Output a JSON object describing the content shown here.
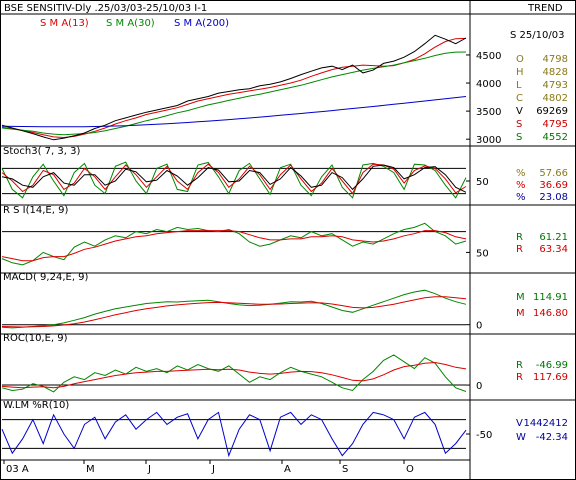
{
  "header": {
    "title": "BSE SENSITIV-Dly .25/03/03-25/10/03  I-1",
    "trend": "TREND"
  },
  "colors": {
    "black": "#000000",
    "red": "#dd0000",
    "green": "#008800",
    "blue": "#0000cc",
    "olive": "#8a7a1a",
    "darkred": "#cc0000",
    "darkgreen": "#007700",
    "navy": "#000099"
  },
  "chart_data": [
    {
      "type": "line",
      "panel": "price",
      "legend": [
        "S M A(13)",
        "S M A(30)",
        "S M A(200)"
      ],
      "date_label": "S 25/10/03",
      "yticks": [
        3000,
        3500,
        4000,
        4500
      ],
      "ylim": [
        2950,
        4980
      ],
      "readouts": [
        {
          "key": "O",
          "value": "4798",
          "color": "olive"
        },
        {
          "key": "H",
          "value": "4828",
          "color": "olive"
        },
        {
          "key": "L",
          "value": "4793",
          "color": "olive"
        },
        {
          "key": "C",
          "value": "4802",
          "color": "olive"
        },
        {
          "key": "V",
          "value": "69269",
          "color": "black"
        },
        {
          "key": "S",
          "value": "4795",
          "color": "darkred"
        },
        {
          "key": "S",
          "value": "4552",
          "color": "darkgreen"
        }
      ],
      "series": [
        {
          "name": "S M A(13)",
          "color": "red",
          "values": [
            3210,
            3190,
            3160,
            3120,
            3080,
            3040,
            3030,
            3050,
            3090,
            3140,
            3200,
            3270,
            3330,
            3380,
            3440,
            3480,
            3520,
            3560,
            3620,
            3680,
            3720,
            3760,
            3800,
            3830,
            3860,
            3890,
            3920,
            3960,
            4000,
            4050,
            4120,
            4180,
            4240,
            4280,
            4300,
            4320,
            4310,
            4300,
            4310,
            4360,
            4420,
            4520,
            4640,
            4740,
            4790,
            4795
          ]
        },
        {
          "name": "S M A(30)",
          "color": "green",
          "values": [
            3200,
            3180,
            3160,
            3140,
            3110,
            3090,
            3080,
            3090,
            3100,
            3120,
            3150,
            3190,
            3230,
            3280,
            3330,
            3370,
            3420,
            3470,
            3510,
            3560,
            3610,
            3650,
            3690,
            3730,
            3770,
            3800,
            3840,
            3880,
            3920,
            3960,
            4010,
            4060,
            4110,
            4150,
            4190,
            4230,
            4260,
            4290,
            4320,
            4360,
            4400,
            4440,
            4490,
            4530,
            4550,
            4552
          ]
        },
        {
          "name": "S M A(200)",
          "color": "blue",
          "values": [
            3230,
            3228,
            3226,
            3224,
            3222,
            3220,
            3220,
            3221,
            3223,
            3226,
            3230,
            3235,
            3241,
            3248,
            3256,
            3265,
            3275,
            3286,
            3297,
            3309,
            3322,
            3335,
            3349,
            3363,
            3378,
            3393,
            3409,
            3425,
            3441,
            3458,
            3475,
            3492,
            3510,
            3528,
            3546,
            3564,
            3583,
            3602,
            3621,
            3640,
            3660,
            3680,
            3700,
            3720,
            3740,
            3760
          ]
        },
        {
          "name": "price",
          "color": "black",
          "values": [
            3250,
            3200,
            3150,
            3100,
            3040,
            2990,
            3020,
            3060,
            3110,
            3190,
            3250,
            3330,
            3380,
            3430,
            3480,
            3520,
            3560,
            3600,
            3680,
            3720,
            3760,
            3820,
            3850,
            3880,
            3900,
            3950,
            3980,
            4020,
            4080,
            4150,
            4210,
            4270,
            4300,
            4240,
            4320,
            4180,
            4230,
            4350,
            4390,
            4460,
            4560,
            4700,
            4850,
            4780,
            4700,
            4802
          ]
        }
      ]
    },
    {
      "type": "line",
      "panel": "stoch",
      "title": "Stoch3( 7, 3, 3)",
      "ylim": [
        0,
        100
      ],
      "yticks": [
        50
      ],
      "hlines": [
        20,
        80
      ],
      "readouts": [
        {
          "key": "%",
          "value": "57.66",
          "color": "olive"
        },
        {
          "key": "%",
          "value": "36.69",
          "color": "darkred"
        },
        {
          "key": "%",
          "value": "23.08",
          "color": "navy"
        }
      ],
      "series": [
        {
          "name": "%",
          "color": "green",
          "values": [
            80,
            30,
            10,
            60,
            90,
            50,
            15,
            70,
            92,
            40,
            20,
            85,
            95,
            50,
            20,
            80,
            90,
            30,
            25,
            88,
            94,
            60,
            20,
            75,
            92,
            55,
            18,
            82,
            90,
            40,
            15,
            60,
            88,
            35,
            10,
            88,
            92,
            85,
            70,
            30,
            90,
            88,
            75,
            40,
            10,
            58
          ]
        },
        {
          "name": "%",
          "color": "red",
          "values": [
            70,
            50,
            25,
            40,
            75,
            65,
            30,
            45,
            80,
            60,
            30,
            60,
            88,
            65,
            35,
            60,
            85,
            50,
            30,
            70,
            90,
            70,
            35,
            55,
            85,
            65,
            30,
            65,
            88,
            55,
            25,
            45,
            80,
            50,
            20,
            70,
            90,
            88,
            78,
            45,
            75,
            86,
            80,
            55,
            22,
            37
          ]
        },
        {
          "name": "%",
          "color": "black",
          "values": [
            60,
            55,
            40,
            35,
            60,
            70,
            45,
            40,
            65,
            65,
            40,
            50,
            78,
            72,
            48,
            52,
            75,
            62,
            40,
            58,
            82,
            76,
            48,
            50,
            75,
            70,
            42,
            55,
            82,
            62,
            35,
            40,
            70,
            58,
            30,
            55,
            85,
            88,
            82,
            55,
            65,
            82,
            84,
            65,
            35,
            23
          ]
        }
      ]
    },
    {
      "type": "line",
      "panel": "rsi",
      "title": "R S I(14,E, 9)",
      "ylim": [
        35,
        85
      ],
      "yticks": [
        50
      ],
      "hlines": [
        70
      ],
      "readouts": [
        {
          "key": "R",
          "value": "61.21",
          "color": "darkgreen"
        },
        {
          "key": "R",
          "value": "63.34",
          "color": "darkred"
        }
      ],
      "series": [
        {
          "name": "R",
          "color": "green",
          "values": [
            44,
            40,
            38,
            42,
            50,
            46,
            43,
            55,
            60,
            56,
            62,
            66,
            64,
            70,
            68,
            72,
            70,
            74,
            72,
            73,
            71,
            70,
            72,
            68,
            60,
            56,
            58,
            62,
            66,
            64,
            70,
            66,
            68,
            62,
            56,
            60,
            58,
            63,
            68,
            72,
            74,
            78,
            70,
            66,
            58,
            61
          ]
        },
        {
          "name": "R",
          "color": "red",
          "values": [
            46,
            44,
            42,
            42,
            45,
            46,
            46,
            49,
            53,
            55,
            58,
            61,
            63,
            65,
            66,
            68,
            69,
            70,
            71,
            71,
            71,
            71,
            71,
            70,
            67,
            64,
            62,
            62,
            63,
            63,
            65,
            65,
            66,
            65,
            62,
            61,
            60,
            61,
            63,
            66,
            68,
            71,
            71,
            69,
            65,
            63
          ]
        }
      ]
    },
    {
      "type": "line",
      "panel": "macd",
      "title": "MACD( 9,24,E, 9)",
      "ylim": [
        -30,
        230
      ],
      "yticks": [
        0
      ],
      "hlines": [
        0
      ],
      "readouts": [
        {
          "key": "M",
          "value": "114.91",
          "color": "darkgreen"
        },
        {
          "key": "M",
          "value": "146.80",
          "color": "darkred"
        }
      ],
      "series": [
        {
          "name": "M",
          "color": "green",
          "values": [
            -15,
            -18,
            -15,
            -10,
            -5,
            0,
            10,
            25,
            40,
            60,
            75,
            90,
            100,
            110,
            120,
            125,
            130,
            128,
            132,
            135,
            138,
            130,
            120,
            112,
            108,
            110,
            115,
            122,
            130,
            128,
            132,
            120,
            100,
            80,
            70,
            90,
            110,
            130,
            150,
            170,
            185,
            195,
            175,
            150,
            130,
            115
          ]
        },
        {
          "name": "M",
          "color": "red",
          "values": [
            -10,
            -12,
            -13,
            -12,
            -10,
            -7,
            -2,
            5,
            15,
            28,
            42,
            56,
            68,
            80,
            90,
            98,
            106,
            112,
            117,
            121,
            125,
            126,
            124,
            121,
            118,
            116,
            116,
            117,
            120,
            122,
            124,
            123,
            117,
            108,
            98,
            95,
            98,
            106,
            116,
            128,
            140,
            152,
            158,
            158,
            152,
            147
          ]
        }
      ]
    },
    {
      "type": "line",
      "panel": "roc",
      "title": "ROC(10,E, 9)",
      "ylim": [
        -80,
        300
      ],
      "yticks": [
        0
      ],
      "hlines": [
        0
      ],
      "readouts": [
        {
          "key": "R",
          "value": "-46.99",
          "color": "darkgreen"
        },
        {
          "key": "R",
          "value": "117.69",
          "color": "darkred"
        }
      ],
      "series": [
        {
          "name": "R",
          "color": "green",
          "values": [
            -20,
            -40,
            -30,
            10,
            -10,
            -50,
            20,
            60,
            40,
            90,
            70,
            110,
            80,
            130,
            100,
            120,
            90,
            140,
            110,
            150,
            120,
            100,
            140,
            80,
            20,
            60,
            40,
            90,
            130,
            100,
            80,
            60,
            20,
            -20,
            -40,
            40,
            100,
            180,
            220,
            170,
            120,
            200,
            160,
            60,
            -20,
            -47
          ]
        },
        {
          "name": "R",
          "color": "red",
          "values": [
            -10,
            -15,
            -20,
            -15,
            -12,
            -20,
            -10,
            10,
            25,
            40,
            55,
            70,
            80,
            90,
            95,
            100,
            100,
            105,
            108,
            112,
            115,
            112,
            115,
            110,
            95,
            85,
            80,
            85,
            95,
            100,
            98,
            90,
            75,
            55,
            35,
            30,
            45,
            75,
            110,
            135,
            145,
            160,
            165,
            150,
            130,
            118
          ]
        }
      ]
    },
    {
      "type": "line",
      "panel": "wlm",
      "title": "W.LM %R(10)",
      "ylim": [
        -100,
        0
      ],
      "yticks": [
        -50
      ],
      "hlines": [
        -20,
        -80
      ],
      "readouts": [
        {
          "key": "V",
          "value": "1442412",
          "color": "navy"
        },
        {
          "key": "W",
          "value": "-42.34",
          "color": "navy"
        }
      ],
      "series": [
        {
          "name": "W",
          "color": "blue",
          "values": [
            -40,
            -90,
            -60,
            -20,
            -70,
            -10,
            -50,
            -80,
            -30,
            -15,
            -60,
            -25,
            -10,
            -40,
            -20,
            -5,
            -30,
            -15,
            -8,
            -60,
            -20,
            -5,
            -95,
            -40,
            -10,
            -20,
            -85,
            -15,
            -5,
            -30,
            -10,
            -20,
            -60,
            -95,
            -70,
            -30,
            -5,
            -10,
            -20,
            -60,
            -15,
            -5,
            -30,
            -90,
            -70,
            -42
          ]
        }
      ]
    }
  ],
  "xaxis": {
    "labels": [
      "03 A",
      "M",
      "J",
      "J",
      "A",
      "S",
      "O"
    ]
  }
}
